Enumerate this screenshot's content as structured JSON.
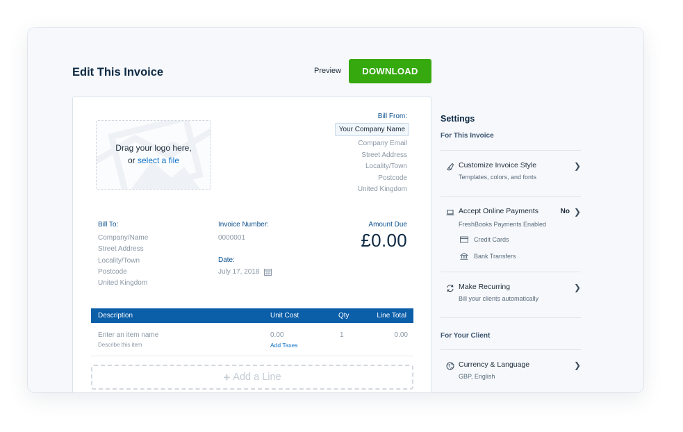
{
  "page": {
    "title": "Edit This Invoice"
  },
  "toolbar": {
    "preview_label": "Preview",
    "download_label": "DOWNLOAD"
  },
  "logo": {
    "line1": "Drag your logo here,",
    "line2_prefix": "or ",
    "line2_link": "select a file"
  },
  "bill_from": {
    "label": "Bill From:",
    "company_name": "Your Company Name",
    "lines": [
      "Company Email",
      "Street Address",
      "Locality/Town",
      "Postcode",
      "United Kingdom"
    ]
  },
  "bill_to": {
    "label": "Bill To:",
    "lines": [
      "Company/Name",
      "Street Address",
      "Locality/Town",
      "Postcode",
      "United Kingdom"
    ]
  },
  "invoice_number": {
    "label": "Invoice Number:",
    "value": "0000001"
  },
  "date": {
    "label": "Date:",
    "value": "July 17, 2018"
  },
  "amount_due": {
    "label": "Amount Due",
    "value": "£0.00"
  },
  "table": {
    "headers": {
      "description": "Description",
      "unit_cost": "Unit Cost",
      "qty": "Qty",
      "line_total": "Line Total"
    },
    "rows": [
      {
        "item_name": "Enter an item name",
        "item_desc": "Describe this item",
        "unit_cost": "0.00",
        "add_taxes": "Add Taxes",
        "qty": "1",
        "line_total": "0.00"
      }
    ],
    "add_line_label": "Add a Line"
  },
  "settings": {
    "title": "Settings",
    "section_invoice": "For This Invoice",
    "customize": {
      "label": "Customize Invoice Style",
      "desc": "Templates, colors, and fonts",
      "icon": "brush-icon"
    },
    "payments": {
      "label": "Accept Online Payments",
      "value": "No",
      "desc": "FreshBooks Payments Enabled",
      "icon": "laptop-icon",
      "methods": [
        {
          "label": "Credit Cards",
          "icon": "credit-card-icon"
        },
        {
          "label": "Bank Transfers",
          "icon": "bank-icon"
        }
      ]
    },
    "recurring": {
      "label": "Make Recurring",
      "desc": "Bill your clients automatically",
      "icon": "recurring-icon"
    },
    "section_client": "For Your Client",
    "currency": {
      "label": "Currency & Language",
      "desc": "GBP, English",
      "icon": "globe-icon"
    }
  },
  "colors": {
    "download_green": "#36a90f",
    "table_header_blue": "#0b5ea8",
    "link_blue": "#0b6fc6",
    "label_blue": "#0a4f8c"
  }
}
